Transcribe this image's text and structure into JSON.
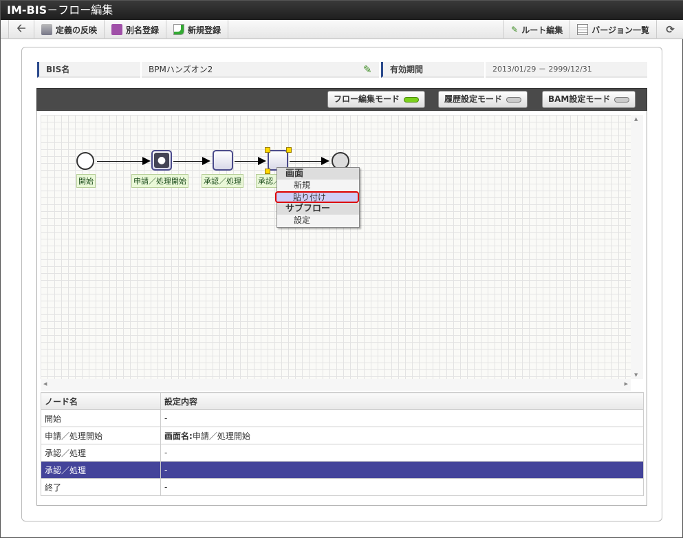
{
  "window": {
    "title_bold": "IM-BIS",
    "title_rest": "－フロー編集"
  },
  "toolbar": {
    "left": [
      "定義の反映",
      "別名登録",
      "新規登録"
    ],
    "right": [
      "ルート編集",
      "バージョン一覧"
    ]
  },
  "info": {
    "bis_label": "BIS名",
    "bis_value": "BPMハンズオン2",
    "period_label": "有効期間",
    "period_value": "2013/01/29 － 2999/12/31"
  },
  "modes": [
    {
      "label": "フロー編集モード",
      "on": true
    },
    {
      "label": "履歴設定モード",
      "on": false
    },
    {
      "label": "BAM設定モード",
      "on": false
    }
  ],
  "nodes": [
    "開始",
    "申請／処理開始",
    "承認／処理",
    "承認／処理"
  ],
  "context_menu": {
    "header1": "画面",
    "item_new": "新規",
    "item_paste": "貼り付け",
    "header2": "サブフロー",
    "item_settings": "設定"
  },
  "table": {
    "headers": [
      "ノード名",
      "設定内容"
    ],
    "rows": [
      {
        "name": "開始",
        "value": "-"
      },
      {
        "name": "申請／処理開始",
        "key": "画面名:",
        "value": "申請／処理開始"
      },
      {
        "name": "承認／処理",
        "value": "-"
      },
      {
        "name": "承認／処理",
        "value": "-",
        "selected": true
      },
      {
        "name": "終了",
        "value": "-"
      }
    ]
  }
}
